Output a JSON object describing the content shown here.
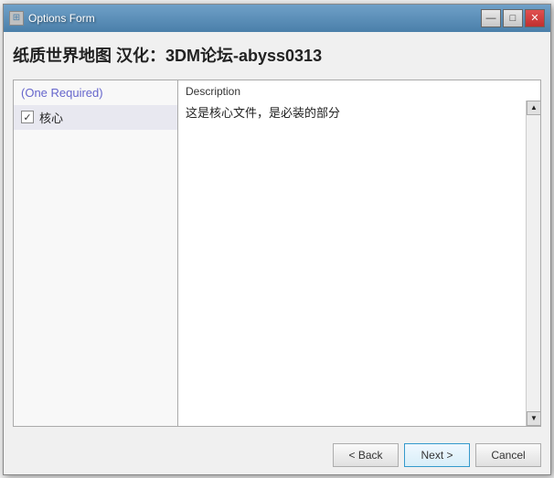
{
  "window": {
    "title": "Options Form",
    "icon": "★"
  },
  "titlebar_buttons": {
    "minimize": "—",
    "maximize": "□",
    "close": "✕"
  },
  "main_title": "纸质世界地图 汉化：3DM论坛-abyss0313",
  "left_panel": {
    "required_label": "(One Required)",
    "options": [
      {
        "id": "core",
        "label": "核心",
        "checked": true
      }
    ]
  },
  "right_panel": {
    "description_header": "Description",
    "description_text": "这是核心文件，是必装的部分"
  },
  "scrollbar": {
    "up_arrow": "▲",
    "down_arrow": "▼"
  },
  "buttons": {
    "back": "< Back",
    "next": "Next >",
    "cancel": "Cancel"
  }
}
